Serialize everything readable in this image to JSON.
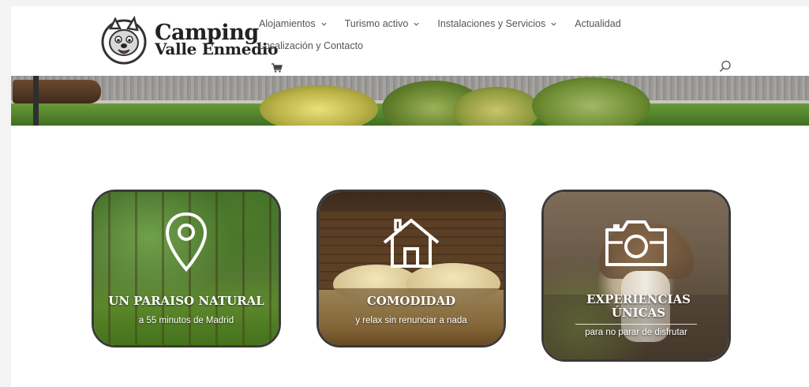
{
  "logo": {
    "line1": "Camping",
    "line2": "Valle Enmedio"
  },
  "nav": {
    "row1": [
      {
        "label": "Alojamientos",
        "has_dropdown": true
      },
      {
        "label": "Turismo activo",
        "has_dropdown": true
      },
      {
        "label": "Instalaciones y Servicios",
        "has_dropdown": true
      },
      {
        "label": "Actualidad",
        "has_dropdown": false
      }
    ],
    "row2": [
      {
        "label": "Localización y Contacto",
        "has_dropdown": false
      }
    ],
    "cart_icon": "cart-icon",
    "search_icon": "search-icon"
  },
  "features": [
    {
      "title": "UN PARAISO NATURAL",
      "subtitle": "a 55 minutos de Madrid",
      "icon": "map-pin-icon"
    },
    {
      "title": "COMODIDAD",
      "subtitle": "y relax sin renunciar a nada",
      "icon": "house-icon"
    },
    {
      "title": "EXPERIENCIAS ÚNICAS",
      "subtitle": "para no parar de disfrutar",
      "icon": "camera-icon"
    }
  ],
  "colors": {
    "text_nav": "#555555",
    "card_border": "#3a3a3a",
    "card_text": "#ffffff"
  }
}
